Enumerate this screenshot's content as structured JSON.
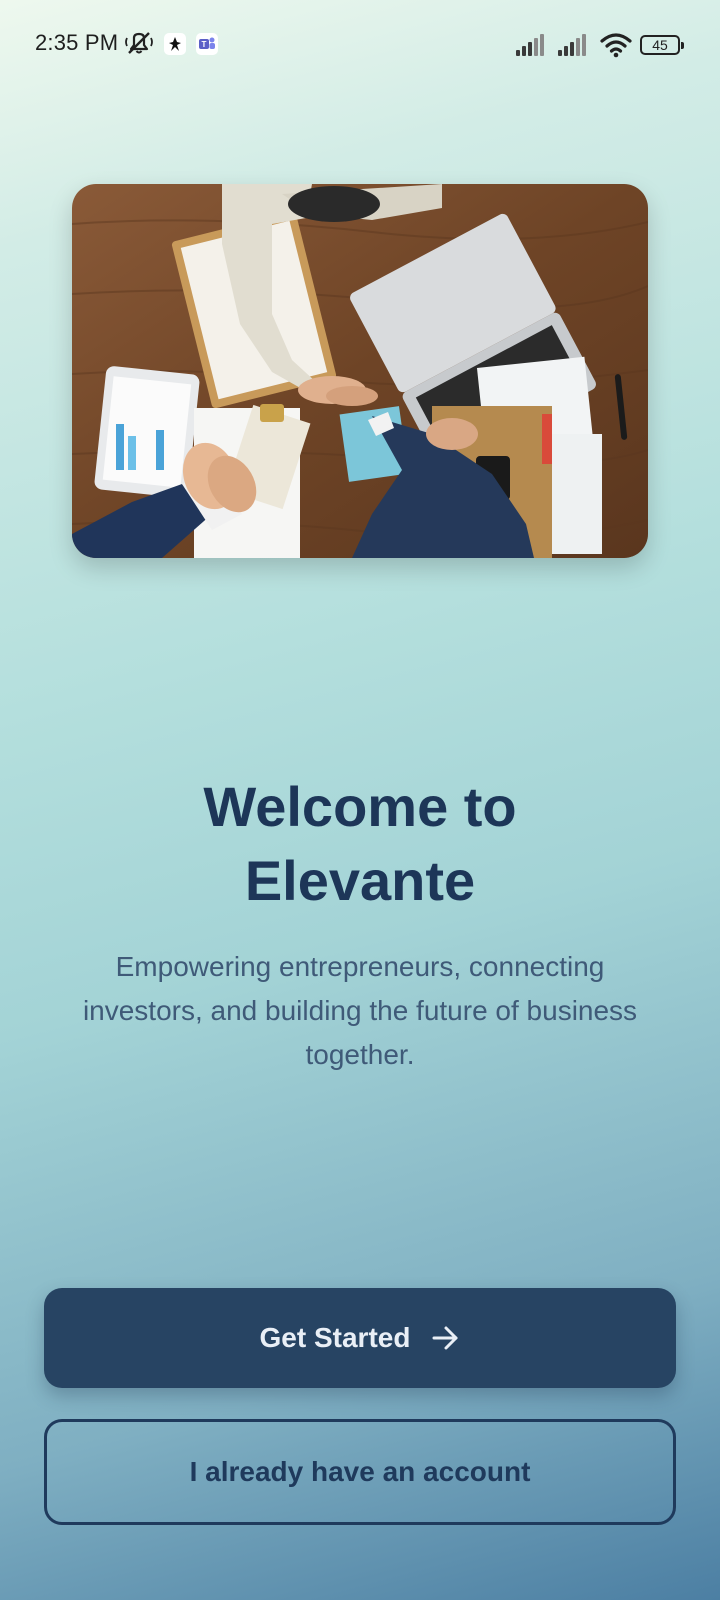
{
  "status_bar": {
    "time": "2:35 PM",
    "battery": "45",
    "icons": [
      "muted-bell-icon",
      "app-notification-icon",
      "teams-icon",
      "signal-icon",
      "signal-icon",
      "wifi-icon",
      "battery-icon"
    ]
  },
  "hero": {
    "image": "business-handshake-photo"
  },
  "welcome": {
    "title_line1": "Welcome to",
    "title_line2": "Elevante",
    "subtitle": "Empowering entrepreneurs, connecting investors, and building the future of business together."
  },
  "actions": {
    "primary_label": "Get Started",
    "primary_icon": "arrow-right-icon",
    "secondary_label": "I already have an account"
  },
  "colors": {
    "title": "#1d3658",
    "primary_button": "#274463",
    "secondary_border": "#1f3a5c"
  }
}
